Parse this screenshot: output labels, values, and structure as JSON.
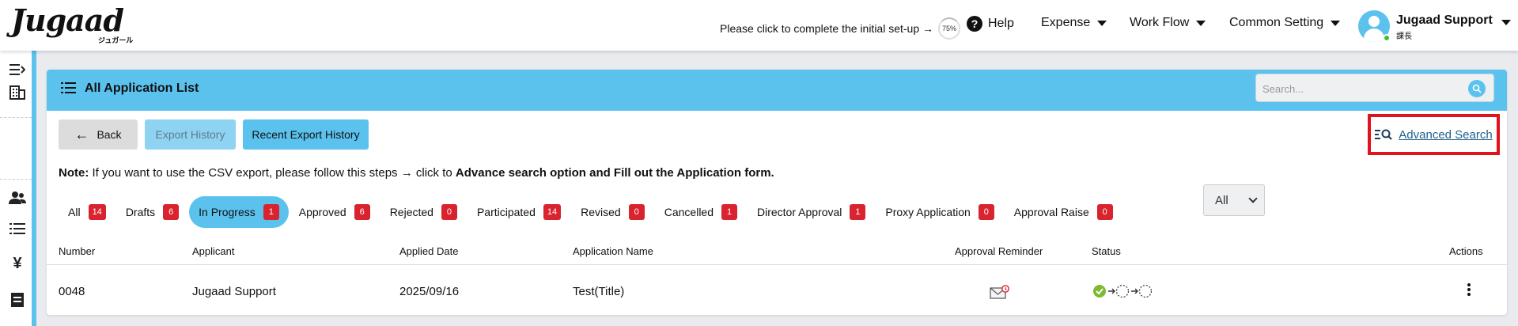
{
  "app": {
    "logo_text": "Jugaad",
    "logo_sub": "ジュガール"
  },
  "topbar": {
    "setup_text": "Please click to complete the initial set-up →",
    "setup_progress": "75%",
    "help_label": "Help",
    "expense_label": "Expense",
    "workflow_label": "Work Flow",
    "common_setting_label": "Common Setting",
    "user_name": "Jugaad Support",
    "user_role": "課長"
  },
  "page": {
    "title": "All Application List",
    "search_placeholder": "Search..."
  },
  "toolbar": {
    "back_label": "Back",
    "export_history_label": "Export History",
    "recent_export_label": "Recent Export History",
    "advanced_search_label": "Advanced Search"
  },
  "note": {
    "label": "Note:",
    "text": " If you want to use the CSV export, please follow this steps → click to ",
    "bold_text": "Advance search option and Fill out the Application form."
  },
  "tabs": [
    {
      "label": "All",
      "count": "14",
      "active": false
    },
    {
      "label": "Drafts",
      "count": "6",
      "active": false
    },
    {
      "label": "In Progress",
      "count": "1",
      "active": true
    },
    {
      "label": "Approved",
      "count": "6",
      "active": false
    },
    {
      "label": "Rejected",
      "count": "0",
      "active": false
    },
    {
      "label": "Participated",
      "count": "14",
      "active": false
    },
    {
      "label": "Revised",
      "count": "0",
      "active": false
    },
    {
      "label": "Cancelled",
      "count": "1",
      "active": false
    },
    {
      "label": "Director Approval",
      "count": "1",
      "active": false
    },
    {
      "label": "Proxy Application",
      "count": "0",
      "active": false
    },
    {
      "label": "Approval Raise",
      "count": "0",
      "active": false
    }
  ],
  "filter_select": {
    "selected": "All"
  },
  "table": {
    "headers": {
      "number": "Number",
      "applicant": "Applicant",
      "applied_date": "Applied Date",
      "application_name": "Application Name",
      "approval_reminder": "Approval Reminder",
      "status": "Status",
      "actions": "Actions"
    },
    "rows": [
      {
        "number": "0048",
        "applicant": "Jugaad Support",
        "applied_date": "2025/09/16",
        "application_name": "Test(Title)"
      }
    ]
  },
  "colors": {
    "accent": "#5bc2ee",
    "badge": "#d9232e",
    "highlight": "#e0131a",
    "status_done": "#7cba2f"
  },
  "icons": {
    "sidebar": [
      "collapse-menu-icon",
      "building-icon",
      "users-icon",
      "list-icon",
      "yen-icon",
      "document-icon"
    ]
  }
}
